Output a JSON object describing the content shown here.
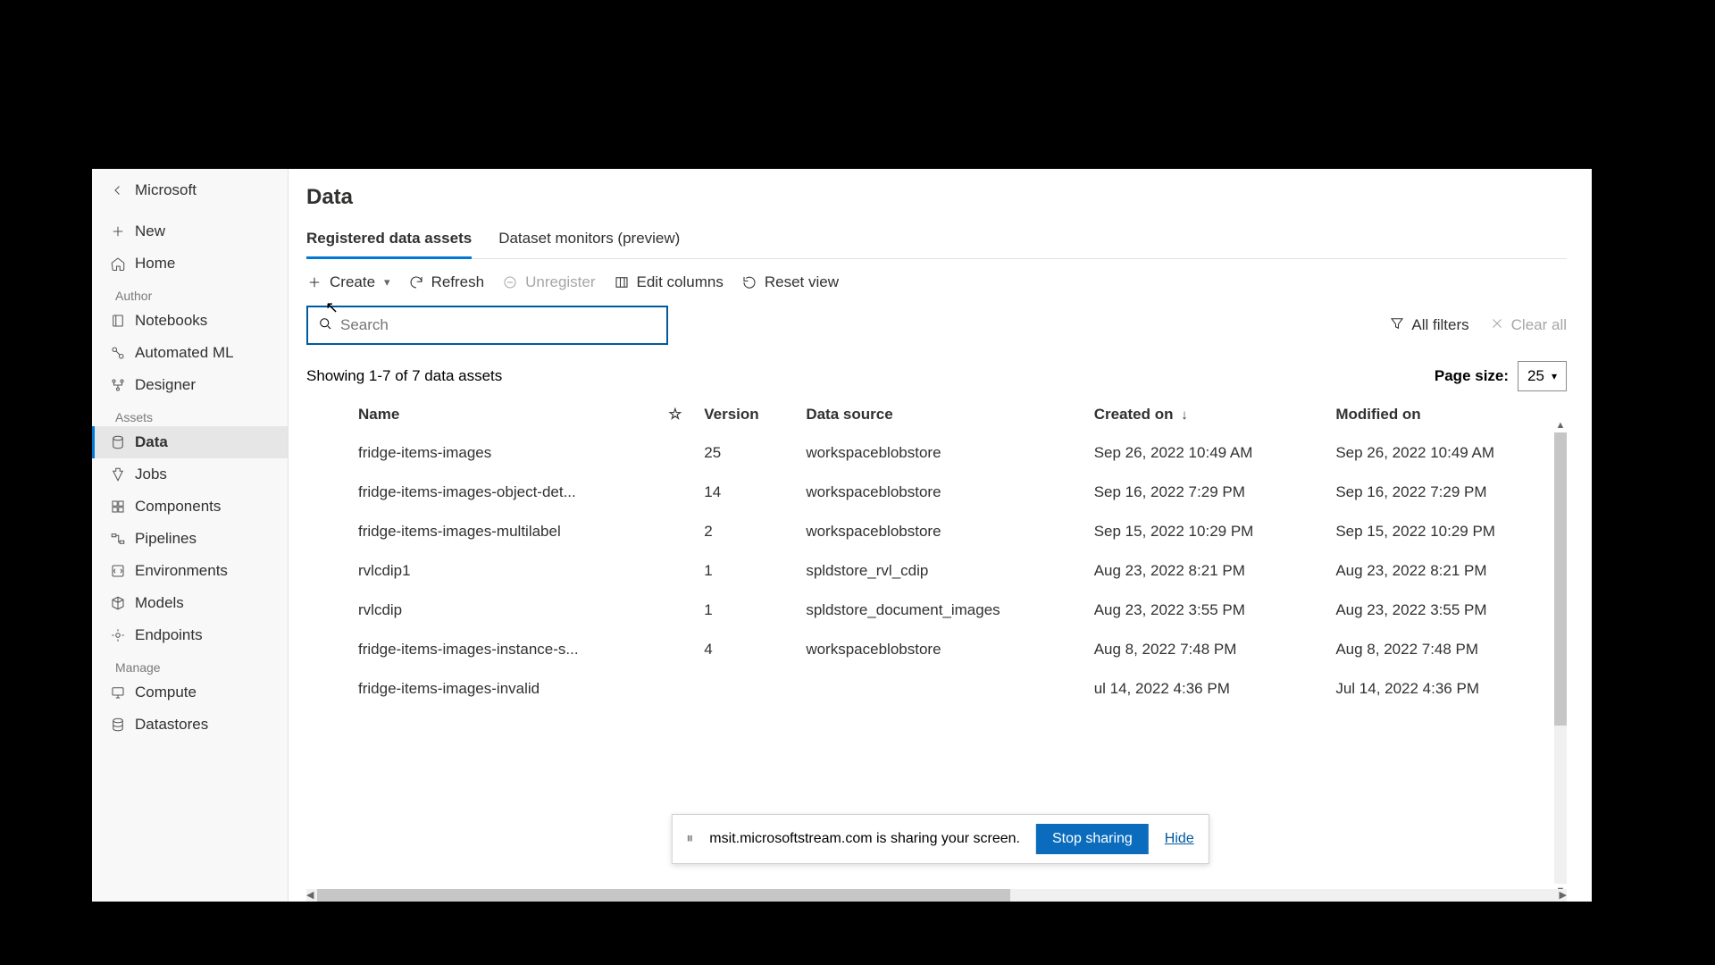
{
  "sidebar": {
    "top": {
      "back_label": "Microsoft",
      "new_label": "New",
      "home_label": "Home"
    },
    "sections": {
      "author": "Author",
      "author_items": [
        {
          "label": "Notebooks"
        },
        {
          "label": "Automated ML"
        },
        {
          "label": "Designer"
        }
      ],
      "assets": "Assets",
      "assets_items": [
        {
          "label": "Data",
          "active": true
        },
        {
          "label": "Jobs"
        },
        {
          "label": "Components"
        },
        {
          "label": "Pipelines"
        },
        {
          "label": "Environments"
        },
        {
          "label": "Models"
        },
        {
          "label": "Endpoints"
        }
      ],
      "manage": "Manage",
      "manage_items": [
        {
          "label": "Compute"
        },
        {
          "label": "Datastores"
        }
      ]
    }
  },
  "page": {
    "title": "Data",
    "tabs": [
      {
        "label": "Registered data assets",
        "active": true
      },
      {
        "label": "Dataset monitors (preview)",
        "active": false
      }
    ]
  },
  "toolbar": {
    "create": "Create",
    "refresh": "Refresh",
    "unregister": "Unregister",
    "edit_columns": "Edit columns",
    "reset_view": "Reset view"
  },
  "search": {
    "placeholder": "Search"
  },
  "filters": {
    "all_filters": "All filters",
    "clear_all": "Clear all"
  },
  "results": {
    "summary": "Showing 1-7 of 7 data assets",
    "page_size_label": "Page size:",
    "page_size_value": "25"
  },
  "table": {
    "headers": {
      "name": "Name",
      "version": "Version",
      "data_source": "Data source",
      "created_on": "Created on",
      "modified_on": "Modified on"
    },
    "sort_column": "created_on",
    "sort_dir": "desc",
    "rows": [
      {
        "name": "fridge-items-images",
        "version": "25",
        "source": "workspaceblobstore",
        "created": "Sep 26, 2022 10:49 AM",
        "modified": "Sep 26, 2022 10:49 AM"
      },
      {
        "name": "fridge-items-images-object-det...",
        "version": "14",
        "source": "workspaceblobstore",
        "created": "Sep 16, 2022 7:29 PM",
        "modified": "Sep 16, 2022 7:29 PM"
      },
      {
        "name": "fridge-items-images-multilabel",
        "version": "2",
        "source": "workspaceblobstore",
        "created": "Sep 15, 2022 10:29 PM",
        "modified": "Sep 15, 2022 10:29 PM"
      },
      {
        "name": "rvlcdip1",
        "version": "1",
        "source": "spldstore_rvl_cdip",
        "created": "Aug 23, 2022 8:21 PM",
        "modified": "Aug 23, 2022 8:21 PM"
      },
      {
        "name": "rvlcdip",
        "version": "1",
        "source": "spldstore_document_images",
        "created": "Aug 23, 2022 3:55 PM",
        "modified": "Aug 23, 2022 3:55 PM"
      },
      {
        "name": "fridge-items-images-instance-s...",
        "version": "4",
        "source": "workspaceblobstore",
        "created": "Aug 8, 2022 7:48 PM",
        "modified": "Aug 8, 2022 7:48 PM"
      },
      {
        "name": "fridge-items-images-invalid",
        "version": "",
        "source": "",
        "created": "ul 14, 2022 4:36 PM",
        "modified": "Jul 14, 2022 4:36 PM"
      }
    ]
  },
  "share_notice": {
    "text": "msit.microsoftstream.com is sharing your screen.",
    "stop": "Stop sharing",
    "hide": "Hide"
  }
}
